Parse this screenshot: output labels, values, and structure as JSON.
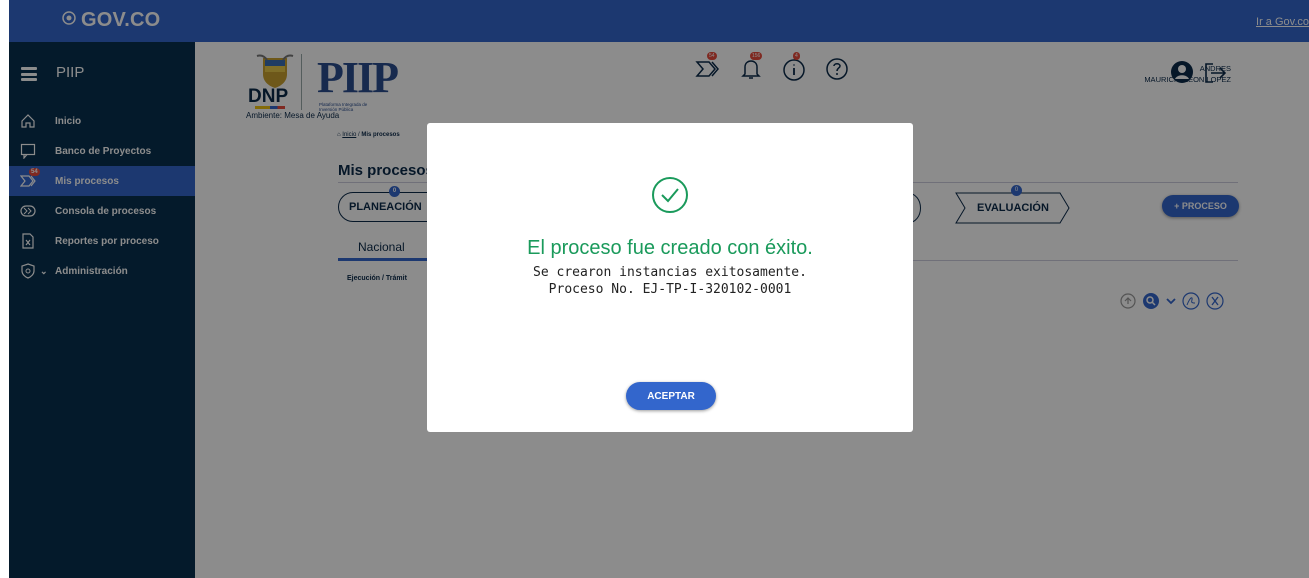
{
  "gov_bar": {
    "logo_text": "GOV.CO",
    "link": "Ir a Gov.co"
  },
  "sidebar": {
    "title": "PIIP",
    "items": [
      {
        "label": "Inicio",
        "icon": "home-icon"
      },
      {
        "label": "Banco de Proyectos",
        "icon": "chat-icon"
      },
      {
        "label": "Mis procesos",
        "icon": "process-icon",
        "badge": "54",
        "active": true
      },
      {
        "label": "Consola de procesos",
        "icon": "console-icon"
      },
      {
        "label": "Reportes por proceso",
        "icon": "excel-report-icon"
      },
      {
        "label": "Administración",
        "icon": "shield-gear-icon"
      }
    ]
  },
  "header": {
    "dnp_text": "DNP",
    "piip_text": "PIIP",
    "piip_subtitle": "Plataforma Integrada de Inversión Pública",
    "ambiente": "Ambiente: Mesa de Ayuda",
    "icon_badges": {
      "procesos": "54",
      "notificaciones": "156",
      "info": "4"
    },
    "user_first": "ANDRES",
    "user_rest": "MAURICIO LEON LOPEZ"
  },
  "main": {
    "breadcrumb_home": "Inicio",
    "breadcrumb_sep": " / ",
    "breadcrumb_current": "Mis procesos",
    "title": "Mis procesos",
    "phases": [
      {
        "label": "PLANEACIÓN",
        "count": "0"
      },
      {
        "label": "EVALUACIÓN",
        "count": "0"
      }
    ],
    "new_process_button": "+ PROCESO",
    "region_tab": "Nacional",
    "table_label": "Ejecución / Trámit"
  },
  "modal": {
    "title": "El proceso fue creado con éxito.",
    "line1": "Se crearon instancias exitosamente.",
    "line2": "Proceso No. EJ-TP-I-320102-0001",
    "accept_button": "ACEPTAR"
  },
  "colors": {
    "gov_blue": "#3366cc",
    "sidebar": "#08304f",
    "success": "#1a9a5b"
  }
}
